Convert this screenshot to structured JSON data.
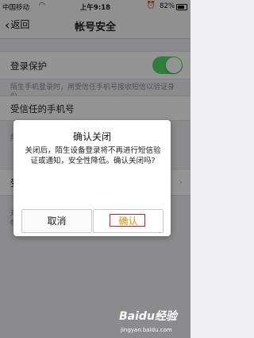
{
  "status_bar": {
    "carrier": "中国移动",
    "time": "上午9:18",
    "battery": "82%"
  },
  "nav": {
    "back_label": "返回",
    "title": "帐号安全"
  },
  "settings": {
    "login_protect_label": "登录保护",
    "login_protect_on": true,
    "login_protect_hint": "陌生手机登录时，用受信任手机号接收短信以验证身份",
    "trusted_phone_label": "受信任的手机号",
    "hint2_partial": "陌生",
    "row3_partial": "受",
    "hint3_partial": "开启",
    "hint3_partial2": "帐号"
  },
  "dialog": {
    "title": "确认关闭",
    "message": "关闭后，陌生设备登录将不再进行短信验证或通知，安全性降低。确认关闭吗?",
    "cancel_label": "取消",
    "confirm_label": "确认"
  },
  "watermark": {
    "brand": "Baidu经验",
    "url": "jingyan.baidu.com"
  },
  "colors": {
    "toggle_on": "#4cd964",
    "confirm_text": "#f08c00",
    "highlight": "#d32020"
  }
}
